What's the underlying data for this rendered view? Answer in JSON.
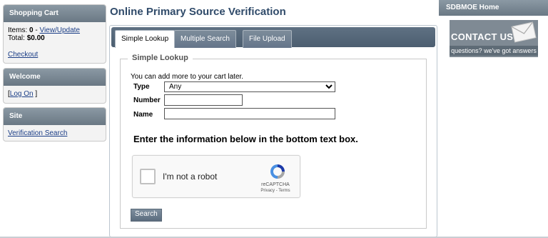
{
  "sidebar": {
    "cart": {
      "title": "Shopping Cart",
      "items_label": "Items:",
      "items_count": "0",
      "items_sep": " - ",
      "view_update": "View/Update",
      "total_label": "Total:",
      "total_value": "$0.00",
      "checkout": "Checkout"
    },
    "welcome": {
      "title": "Welcome",
      "bracket_open": "[",
      "log_on": "Log On",
      "bracket_close": " ]"
    },
    "site": {
      "title": "Site",
      "verification_search": "Verification Search"
    }
  },
  "page": {
    "title": "Online Primary Source Verification"
  },
  "tabs": [
    {
      "label": "Simple Lookup",
      "active": true
    },
    {
      "label": "Multiple Search",
      "active": false
    },
    {
      "label": "File Upload",
      "active": false
    }
  ],
  "form": {
    "legend": "Simple Lookup",
    "note": "You can add more to your cart later.",
    "type_label": "Type",
    "type_value": "Any",
    "number_label": "Number",
    "number_value": "",
    "name_label": "Name",
    "name_value": "",
    "instructions": "Enter the information below in the bottom text box.",
    "captcha": {
      "text": "I'm not a robot",
      "brand": "reCAPTCHA",
      "privacy": "Privacy",
      "sep": " - ",
      "terms": "Terms"
    },
    "search_button": "Search"
  },
  "right": {
    "home": "SDBMOE Home",
    "contact_title": "CONTACT US",
    "contact_sub": "questions? we've got answers"
  },
  "colors": {
    "header_gradient_top": "#8b99a4",
    "header_gradient_bottom": "#6a7884",
    "title_blue": "#304b6a",
    "tabbar": "#4c5e70"
  }
}
